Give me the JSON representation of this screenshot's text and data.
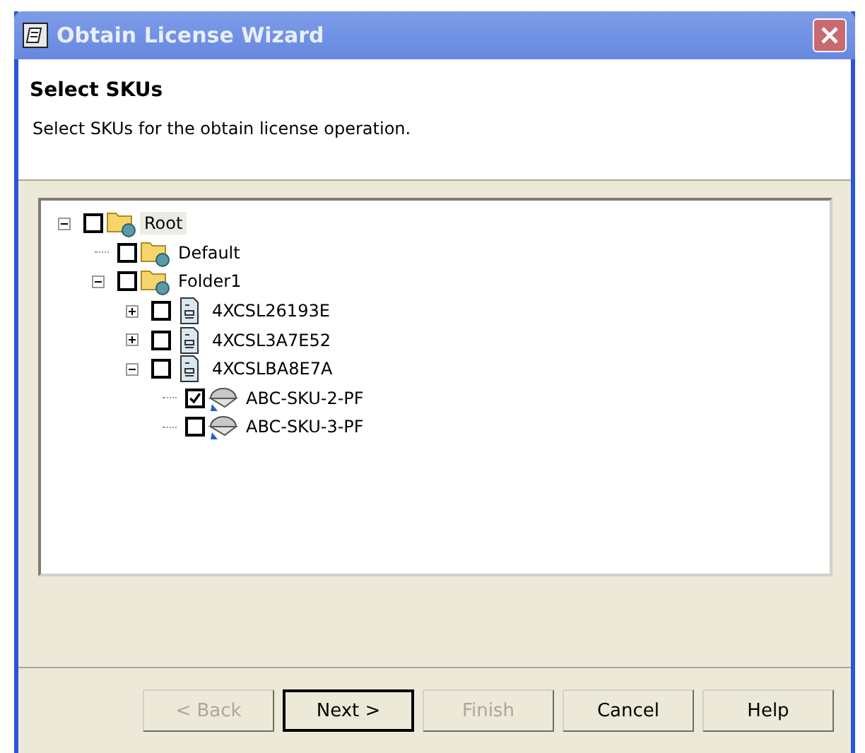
{
  "window": {
    "title": "Obtain License Wizard"
  },
  "header": {
    "title": "Select SKUs",
    "subtitle": "Select SKUs for the obtain license operation."
  },
  "tree": [
    {
      "label": "Root",
      "kind": "folder",
      "checked": false,
      "selected": true,
      "expanded": true,
      "children": [
        {
          "label": "Default",
          "kind": "folder",
          "checked": false,
          "selected": false
        },
        {
          "label": "Folder1",
          "kind": "folder",
          "checked": false,
          "selected": false,
          "expanded": true,
          "children": [
            {
              "label": "4XCSL26193E",
              "kind": "document",
              "checked": false,
              "selected": false,
              "expanded": false
            },
            {
              "label": "4XCSL3A7E52",
              "kind": "document",
              "checked": false,
              "selected": false,
              "expanded": false
            },
            {
              "label": "4XCSLBA8E7A",
              "kind": "document",
              "checked": false,
              "selected": false,
              "expanded": true,
              "children": [
                {
                  "label": "ABC-SKU-2-PF",
                  "kind": "sku",
                  "checked": true,
                  "selected": false
                },
                {
                  "label": "ABC-SKU-3-PF",
                  "kind": "sku",
                  "checked": false,
                  "selected": false
                }
              ]
            }
          ]
        }
      ]
    }
  ],
  "buttons": [
    {
      "label": "< Back",
      "disabled": true,
      "default": false
    },
    {
      "label": "Next >",
      "disabled": false,
      "default": true
    },
    {
      "label": "Finish",
      "disabled": true,
      "default": false
    },
    {
      "label": "Cancel",
      "disabled": false,
      "default": false
    },
    {
      "label": "Help",
      "disabled": false,
      "default": false
    }
  ]
}
